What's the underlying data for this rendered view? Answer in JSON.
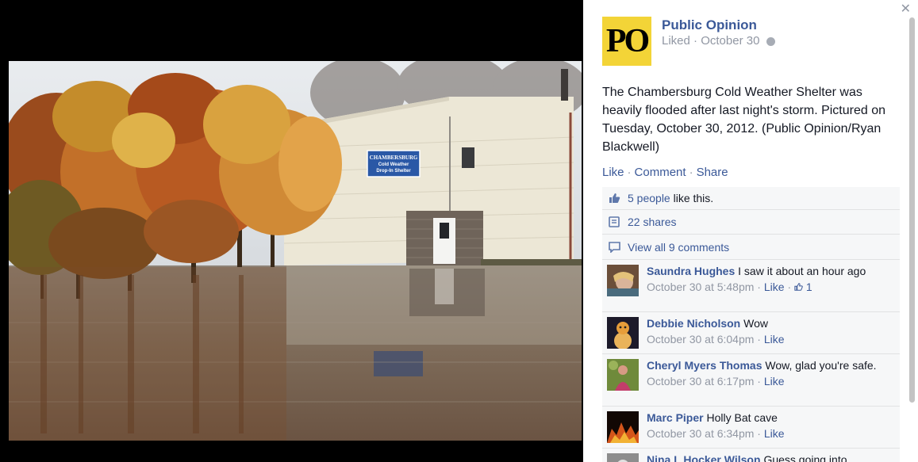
{
  "page": {
    "name": "Public Opinion",
    "logo_text": "PO",
    "status": "Liked",
    "date": "October 30"
  },
  "post": {
    "caption": "The Chambersburg Cold Weather Shelter was heavily flooded after last night's storm. Pictured on Tuesday, October 30, 2012. (Public Opinion/Ryan Blackwell)",
    "sign_lines": [
      "CHAMBERSBURG",
      "Cold Weather",
      "Drop-In Shelter"
    ]
  },
  "actions": {
    "like": "Like",
    "comment": "Comment",
    "share": "Share"
  },
  "summary": {
    "likes_link": "5 people",
    "likes_rest": " like this.",
    "shares": "22 shares",
    "view_comments": "View all 9 comments"
  },
  "comments": [
    {
      "author": "Saundra Hughes",
      "text": "I saw it about an hour ago",
      "time": "October 30 at 5:48pm",
      "like": "Like",
      "likes_count": "1"
    },
    {
      "author": "Debbie Nicholson",
      "text": "Wow",
      "time": "October 30 at 6:04pm",
      "like": "Like"
    },
    {
      "author": "Cheryl Myers Thomas",
      "text": "Wow, glad you're safe.",
      "time": "October 30 at 6:17pm",
      "like": "Like"
    },
    {
      "author": "Marc Piper",
      "text": "Holly Bat cave",
      "time": "October 30 at 6:34pm",
      "like": "Like"
    },
    {
      "author": "Nina L Hocker Wilson",
      "text": "Guess going into"
    }
  ],
  "icons": {
    "close": "close-icon",
    "globe": "globe-icon",
    "like": "thumbs-up-icon",
    "share": "shares-icon",
    "comment": "comment-bubble-icon"
  },
  "colors": {
    "link": "#3b5998",
    "meta": "#9197a3",
    "logo_bg": "#f3d437"
  }
}
